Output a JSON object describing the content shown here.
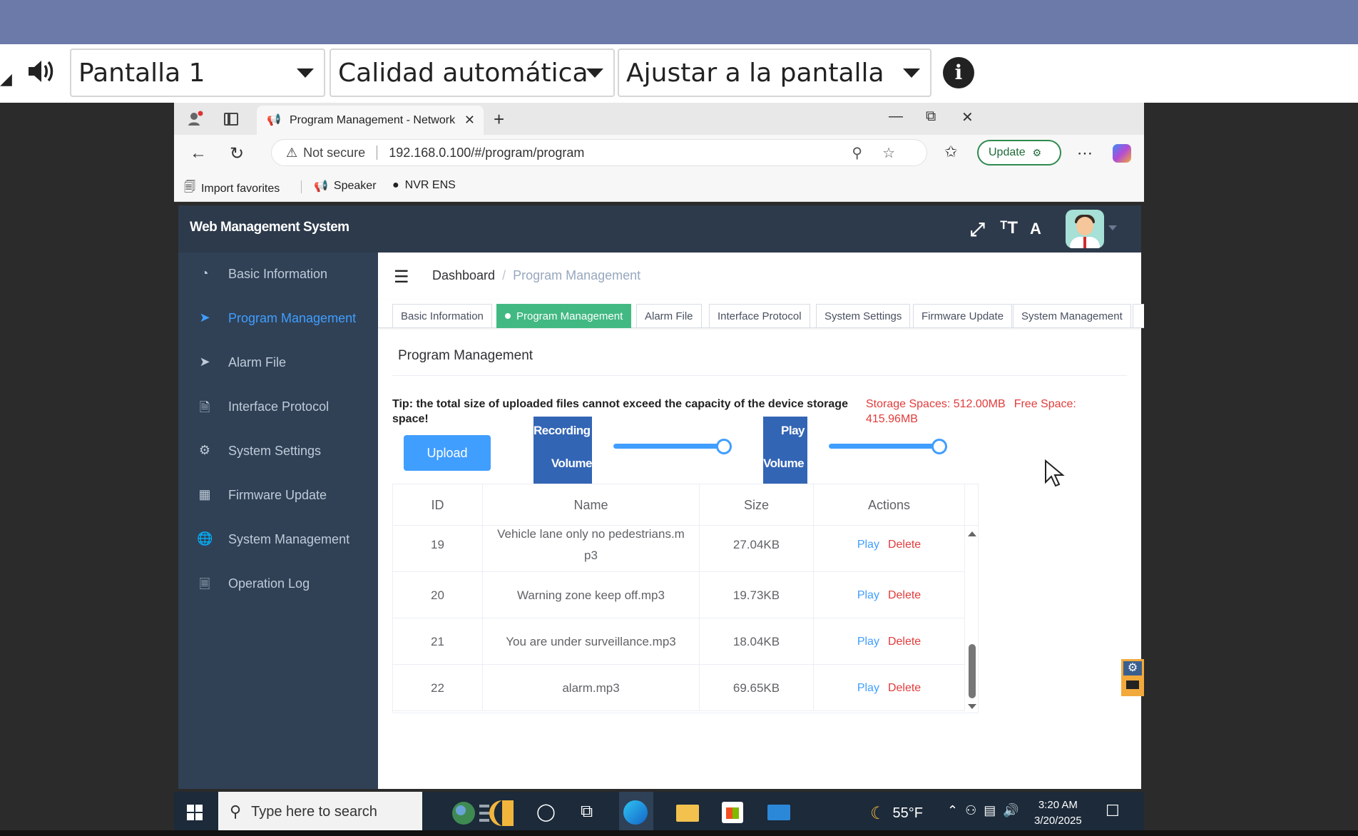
{
  "viewer": {
    "screen_select": "Pantalla 1",
    "quality_select": "Calidad automática",
    "fit_select": "Ajustar a la pantalla"
  },
  "browser": {
    "tab_title": "Program Management - Network",
    "url_warning": "Not secure",
    "url": "192.168.0.100/#/program/program",
    "update_label": "Update",
    "favorites": [
      "Import favorites",
      "Speaker",
      "NVR ENS"
    ]
  },
  "app": {
    "title": "Web Management System"
  },
  "sidebar": {
    "items": [
      {
        "label": "Basic Information",
        "icon": "dashboard-icon"
      },
      {
        "label": "Program Management",
        "icon": "send-icon",
        "active": true
      },
      {
        "label": "Alarm File",
        "icon": "send-icon"
      },
      {
        "label": "Interface Protocol",
        "icon": "document-icon"
      },
      {
        "label": "System Settings",
        "icon": "gear-icon"
      },
      {
        "label": "Firmware Update",
        "icon": "grid-icon"
      },
      {
        "label": "System Management",
        "icon": "globe-icon"
      },
      {
        "label": "Operation Log",
        "icon": "log-icon"
      }
    ]
  },
  "breadcrumb": {
    "home": "Dashboard",
    "separator": "/",
    "current": "Program Management"
  },
  "tags": [
    {
      "label": "Basic Information"
    },
    {
      "label": "Program Management",
      "active": true
    },
    {
      "label": "Alarm File"
    },
    {
      "label": "Interface Protocol"
    },
    {
      "label": "System Settings"
    },
    {
      "label": "Firmware Update"
    },
    {
      "label": "System Management"
    }
  ],
  "card": {
    "title": "Program Management",
    "tip": "Tip: the total size of uploaded files cannot exceed the capacity of the device storage space!",
    "storage": "Storage Spaces: 512.00MB",
    "free": "Free Space: 415.96MB",
    "upload_label": "Upload",
    "recording_volume": {
      "line1": "Recording",
      "line2": "Volume",
      "level": 1.0
    },
    "play_volume": {
      "line1": "Play",
      "line2": "Volume",
      "level": 1.0
    }
  },
  "table": {
    "columns": [
      "ID",
      "Name",
      "Size",
      "Actions"
    ],
    "rows": [
      {
        "id": "19",
        "name": "Vehicle lane only no pedestrians.mp3",
        "size": "27.04KB"
      },
      {
        "id": "20",
        "name": "Warning zone keep off.mp3",
        "size": "19.73KB"
      },
      {
        "id": "21",
        "name": "You are under surveillance.mp3",
        "size": "18.04KB"
      },
      {
        "id": "22",
        "name": "alarm.mp3",
        "size": "69.65KB"
      }
    ],
    "play_label": "Play",
    "delete_label": "Delete"
  },
  "taskbar": {
    "search_placeholder": "Type here to search",
    "temperature": "55°F",
    "time": "3:20 AM",
    "date": "3/20/2025"
  }
}
